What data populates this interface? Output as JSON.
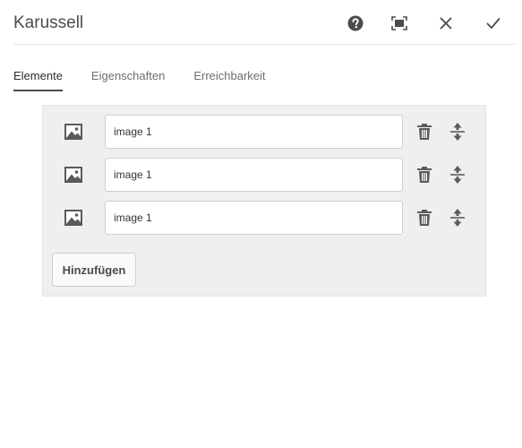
{
  "dialog": {
    "title": "Karussell",
    "buttons": {
      "help": "help-icon",
      "fullscreen": "fullscreen-icon",
      "close": "close-icon",
      "confirm": "checkmark-icon"
    }
  },
  "tabs": [
    {
      "label": "Elemente",
      "active": true
    },
    {
      "label": "Eigenschaften",
      "active": false
    },
    {
      "label": "Erreichbarkeit",
      "active": false
    }
  ],
  "items": [
    {
      "icon": "image-icon",
      "value": "image 1"
    },
    {
      "icon": "image-icon",
      "value": "image 1"
    },
    {
      "icon": "image-icon",
      "value": "image 1"
    }
  ],
  "add_label": "Hinzufügen",
  "colors": {
    "panel_bg": "#efefef",
    "icon": "#5a5a5a"
  }
}
